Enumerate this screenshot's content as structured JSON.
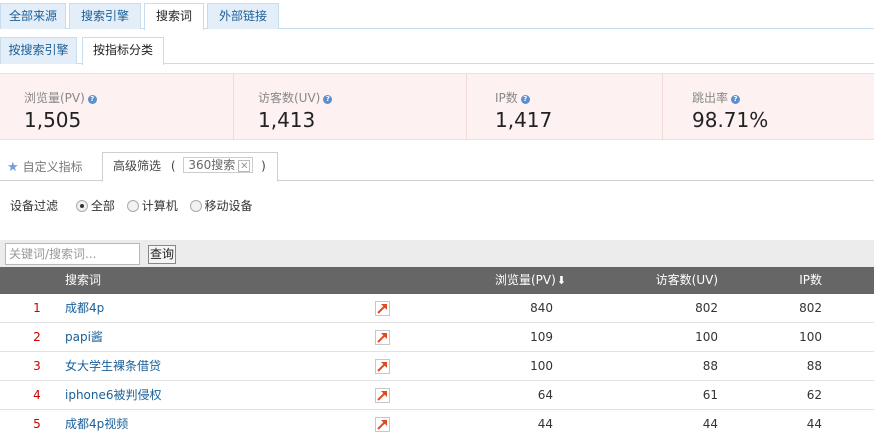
{
  "tabs_top": [
    "全部来源",
    "搜索引擎",
    "搜索词",
    "外部链接"
  ],
  "tabs_sub": [
    "按搜索引擎",
    "按指标分类"
  ],
  "stats": [
    {
      "label": "浏览量(PV)",
      "value": "1,505"
    },
    {
      "label": "访客数(UV)",
      "value": "1,413"
    },
    {
      "label": "IP数",
      "value": "1,417"
    },
    {
      "label": "跳出率",
      "value": "98.71%"
    }
  ],
  "toolbar": {
    "custom_metrics": "自定义指标",
    "advanced_filter": "高级筛选",
    "paren_open": "(",
    "paren_close": ")",
    "filter_chip": "360搜索",
    "close_glyph": "✕"
  },
  "device_filter": {
    "label": "设备过滤",
    "options": [
      "全部",
      "计算机",
      "移动设备"
    ],
    "selected": "全部"
  },
  "search": {
    "placeholder": "关键词/搜索词...",
    "button": "查询"
  },
  "table": {
    "columns": [
      "搜索词",
      "浏览量(PV)",
      "访客数(UV)",
      "IP数"
    ],
    "sort_glyph": "🡓",
    "rows": [
      {
        "index": "1",
        "keyword": "成都4p",
        "pv": "840",
        "uv": "802",
        "ip": "802"
      },
      {
        "index": "2",
        "keyword": "papi酱",
        "pv": "109",
        "uv": "100",
        "ip": "100"
      },
      {
        "index": "3",
        "keyword": "女大学生裸条借贷",
        "pv": "100",
        "uv": "88",
        "ip": "88"
      },
      {
        "index": "4",
        "keyword": "iphone6被判侵权",
        "pv": "64",
        "uv": "61",
        "ip": "62"
      },
      {
        "index": "5",
        "keyword": "成都4p视频",
        "pv": "44",
        "uv": "44",
        "ip": "44"
      }
    ]
  },
  "colors": {
    "link": "#1a5f98",
    "index": "#cc0000",
    "trend_icon": "#e04a1f",
    "header_bg": "#666666"
  },
  "icons": {
    "star": "star-icon",
    "help": "help-icon",
    "trend": "trend-arrow-icon",
    "sort": "sort-desc-icon"
  }
}
